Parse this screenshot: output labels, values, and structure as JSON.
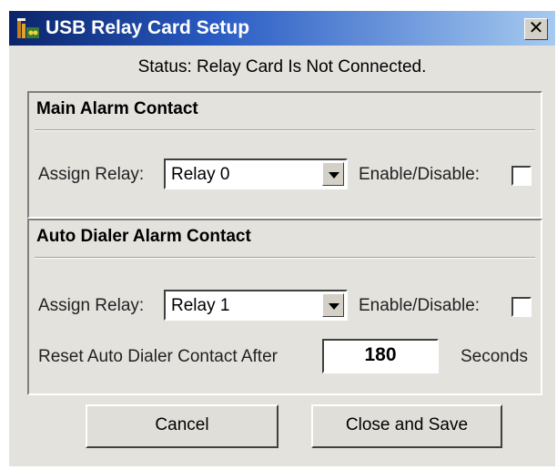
{
  "window": {
    "title": "USB Relay Card Setup",
    "close_glyph": "✕",
    "icon": "relay-card-icon"
  },
  "status": "Status: Relay Card Is Not Connected.",
  "main_alarm": {
    "title": "Main Alarm Contact",
    "assign_label": "Assign Relay:",
    "relay_value": "Relay 0",
    "enable_label": "Enable/Disable:",
    "enabled": false
  },
  "auto_dialer": {
    "title": "Auto Dialer Alarm Contact",
    "assign_label": "Assign Relay:",
    "relay_value": "Relay 1",
    "enable_label": "Enable/Disable:",
    "enabled": false,
    "reset_label": "Reset Auto Dialer Contact After",
    "reset_value": "180",
    "seconds_label": "Seconds"
  },
  "buttons": {
    "cancel": "Cancel",
    "save": "Close and Save"
  }
}
